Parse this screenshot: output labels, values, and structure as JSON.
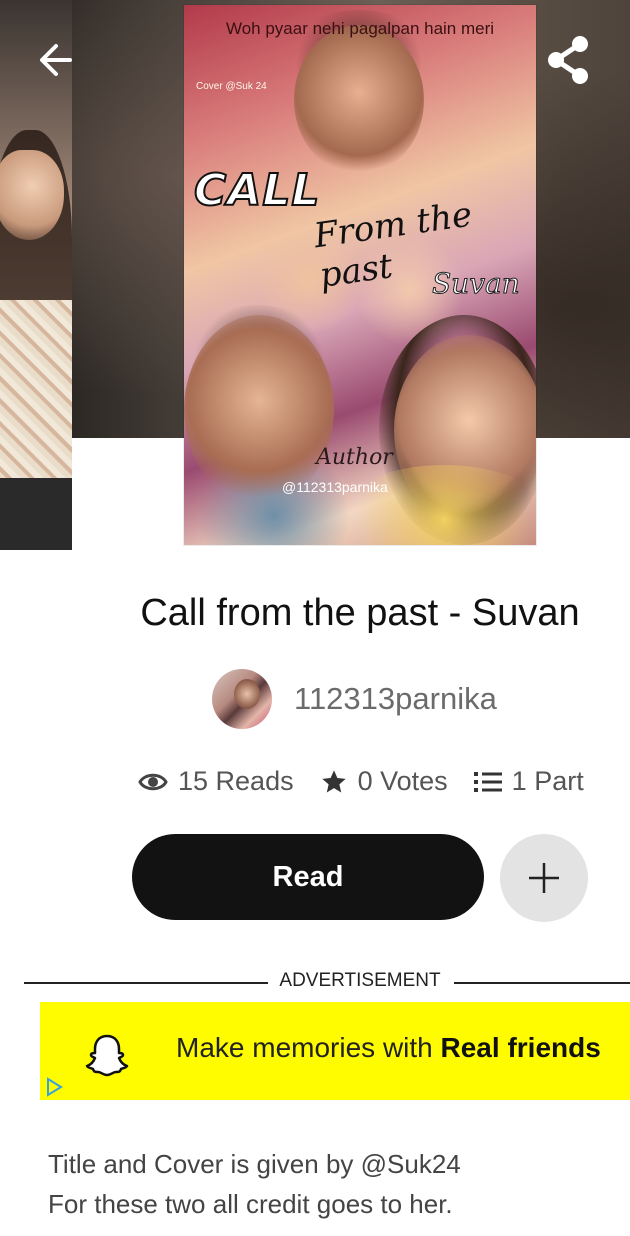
{
  "cover": {
    "top_text": "Woh pyaar nehi pagalpan hain meri",
    "small_credit": "Cover @Suk 24",
    "title_word_1": "CALL",
    "title_word_2": "From the past",
    "title_word_3": "Suvan",
    "author_label": "Author",
    "author_handle": "@112313parnika"
  },
  "icons": {
    "back": "arrow-left-icon",
    "share": "share-icon",
    "reads": "eye-icon",
    "votes": "star-icon",
    "parts": "list-icon",
    "add": "plus-icon",
    "ad_brand": "snapchat-ghost-icon",
    "ad_choice": "ad-choices-icon"
  },
  "story": {
    "title": "Call from the past - Suvan",
    "author": "112313parnika",
    "reads": "15 Reads",
    "votes": "0 Votes",
    "parts": "1 Part"
  },
  "actions": {
    "read_label": "Read"
  },
  "ad": {
    "label": "ADVERTISEMENT",
    "text_regular": "Make memories with ",
    "text_bold": "Real friends",
    "color": "#fffc00"
  },
  "description": {
    "line1": "Title and Cover is given by @Suk24",
    "line2": "For these two all credit goes to her."
  },
  "colors": {
    "read_button": "#121212",
    "add_button": "#e3e3e3"
  }
}
